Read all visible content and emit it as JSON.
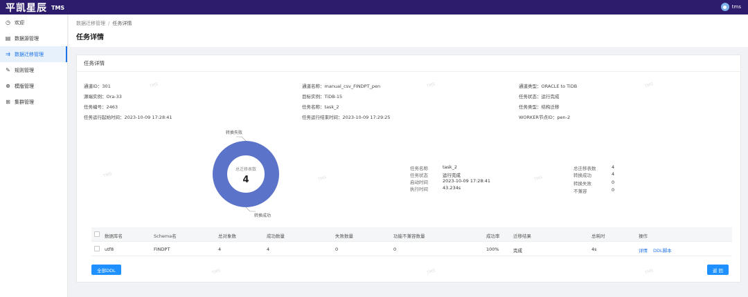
{
  "topbar": {
    "brand": "平凯星辰",
    "product": "TMS",
    "user": "tms"
  },
  "sidebar": {
    "items": [
      {
        "label": "欢迎",
        "icon": "clock-icon"
      },
      {
        "label": "数据源管理",
        "icon": "database-icon"
      },
      {
        "label": "数据迁移管理",
        "icon": "migration-icon"
      },
      {
        "label": "规则管理",
        "icon": "edit-icon"
      },
      {
        "label": "模版管理",
        "icon": "globe-icon"
      },
      {
        "label": "集群管理",
        "icon": "grid-icon"
      }
    ],
    "active_index": 2
  },
  "breadcrumb": {
    "parent": "数据迁移管理",
    "separator": "/",
    "current": "任务详情"
  },
  "page_title": "任务详情",
  "card_title": "任务详情",
  "info": {
    "channel_id": "通道ID：301",
    "channel_name": "通道名称：manual_csv_FINDPT_pen",
    "channel_type": "通道类型：ORACLE to TiDB",
    "source_instance": "源端实例：Ora-33",
    "target_instance": "目标实例：TiDB-15",
    "task_status": "任务状态：运行完成",
    "task_no": "任务编号：2463",
    "task_name": "任务名称：task_2",
    "task_type": "任务类型：结构迁移",
    "start_time": "任务运行起始时间：2023-10-09 17:28:41",
    "end_time": "任务运行结束时间：2023-10-09 17:29:25",
    "worker": "WORKER节点ID：pen-2"
  },
  "chart_data": {
    "type": "pie",
    "categories": [
      "转换失败",
      "转换成功"
    ],
    "values": [
      0,
      4
    ],
    "center_label": "总迁移表数",
    "center_value": "4",
    "colors": [
      "#5b73c8"
    ]
  },
  "task_meta": {
    "labels": [
      "任务名称",
      "任务状态",
      "启动时间",
      "执行时间"
    ],
    "values": [
      "task_2",
      "运行完成",
      "2023-10-09 17:28:41",
      "43.234s"
    ]
  },
  "summary": {
    "labels": [
      "总迁移表数",
      "转换成功",
      "转换失败",
      "不兼容"
    ],
    "values": [
      "4",
      "4",
      "0",
      "0"
    ]
  },
  "table": {
    "headers": [
      "数据库名",
      "Schema名",
      "总对象数",
      "成功数量",
      "失败数量",
      "功能不兼容数量",
      "成功率",
      "迁移结果",
      "总耗时",
      "操作"
    ],
    "rows": [
      {
        "db": "utf8",
        "schema": "FINDPT",
        "total": "4",
        "success": "4",
        "fail": "0",
        "incompatible": "0",
        "rate": "100%",
        "result": "完成",
        "duration": "4s",
        "action_detail": "详情",
        "action_ddl": "DDL脚本"
      }
    ]
  },
  "buttons": {
    "all_ddl": "全部DDL",
    "back": "返 回"
  },
  "watermark": "TMS"
}
